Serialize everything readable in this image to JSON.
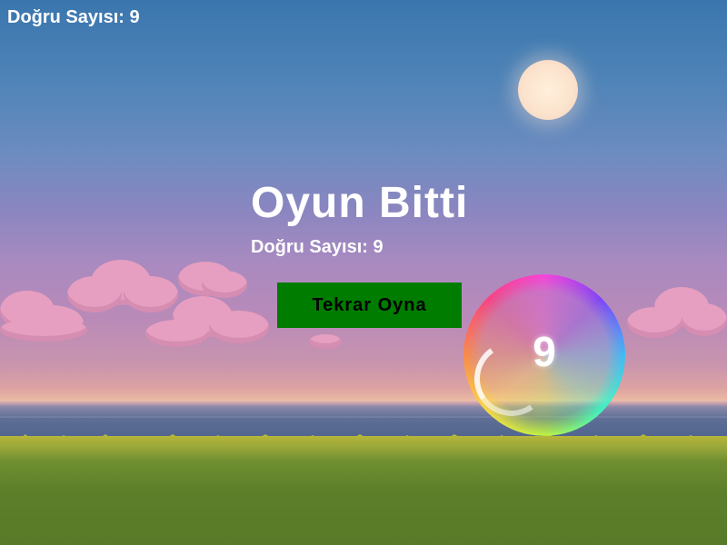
{
  "hud": {
    "score_text": "Doğru Sayısı: 9"
  },
  "game_over": {
    "title": "Oyun Bitti",
    "final_score_text": "Doğru Sayısı: 9",
    "replay_label": "Tekrar Oyna"
  },
  "bubble": {
    "number": "9"
  },
  "colors": {
    "button": "#007c00",
    "text": "#ffffff",
    "cloud": "#e69fc0",
    "grass": "#6f8f31"
  },
  "icons": {
    "sun": "sun-icon",
    "bubble": "rainbow-bubble-icon"
  }
}
